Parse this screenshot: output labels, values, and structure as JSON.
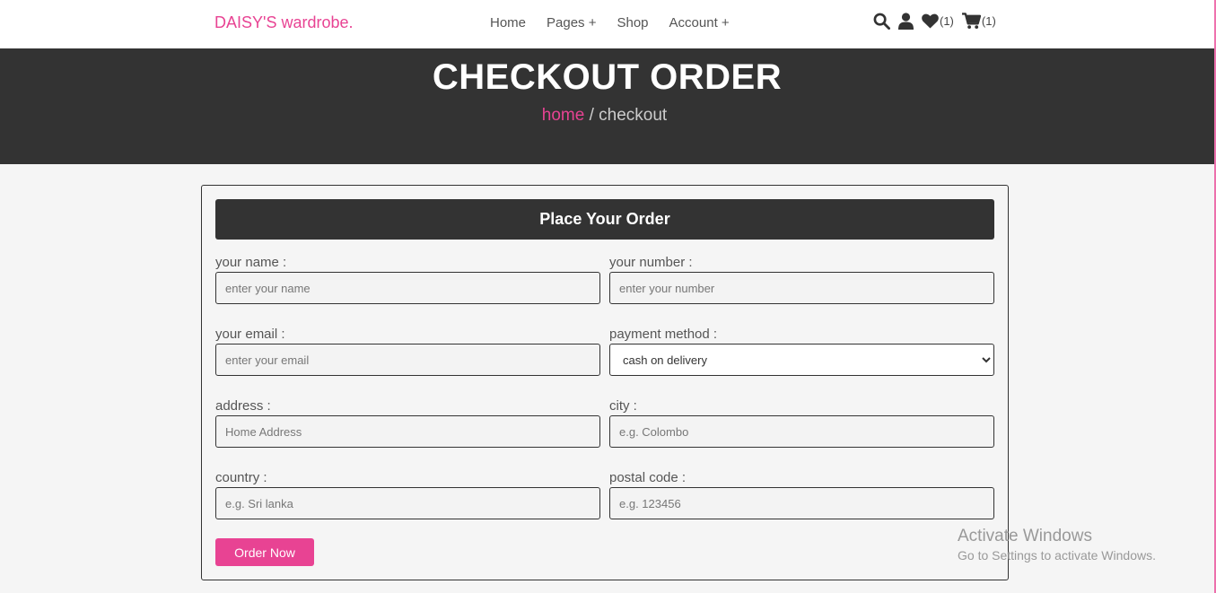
{
  "nav": {
    "logo": "DAISY'S wardrobe.",
    "links": [
      "Home",
      "Pages +",
      "Shop",
      "Account +"
    ],
    "wishlist_count": "(1)",
    "cart_count": "(1)"
  },
  "hero": {
    "title": "CHECKOUT ORDER",
    "breadcrumb_home": "home",
    "breadcrumb_sep": " / ",
    "breadcrumb_current": "checkout"
  },
  "form": {
    "heading": "Place Your Order",
    "name": {
      "label": "your name :",
      "placeholder": "enter your name"
    },
    "number": {
      "label": "your number :",
      "placeholder": "enter your number"
    },
    "email": {
      "label": "your email :",
      "placeholder": "enter your email"
    },
    "payment": {
      "label": "payment method :",
      "selected": "cash on delivery"
    },
    "address": {
      "label": "address :",
      "placeholder": "Home Address"
    },
    "city": {
      "label": "city :",
      "placeholder": "e.g. Colombo"
    },
    "country": {
      "label": "country :",
      "placeholder": "e.g. Sri lanka"
    },
    "postal": {
      "label": "postal code :",
      "placeholder": "e.g. 123456"
    },
    "submit_label": "Order Now"
  },
  "watermark": {
    "line1": "Activate Windows",
    "line2": "Go to Settings to activate Windows."
  },
  "colors": {
    "accent": "#e84393",
    "dark": "#333333",
    "background": "#f5f5f5"
  },
  "icons": [
    "search-icon",
    "user-icon",
    "heart-icon",
    "cart-icon"
  ]
}
